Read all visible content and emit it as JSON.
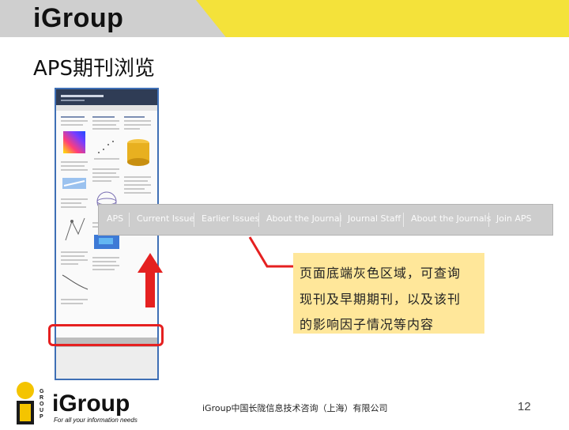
{
  "header": {
    "logo_text": "iGroup",
    "grey": "#cfcfcf",
    "yellow": "#f4e23a"
  },
  "slide": {
    "title": "APS期刊浏览"
  },
  "navbar": {
    "items": [
      "APS",
      "Current Issue",
      "Earlier Issues",
      "About the Journal",
      "Journal Staff",
      "About the Journals",
      "Join APS"
    ]
  },
  "callout": {
    "lines": [
      "页面底端灰色区域，可查询",
      "现刊及早期期刊，以及该刊",
      "的影响因子情况等内容"
    ],
    "color": "#ffe79a"
  },
  "highlight": {
    "color": "#e52020"
  },
  "footer": {
    "logo_text": "iGroup",
    "logo_vertical": "GROUP",
    "tagline": "For all your information needs",
    "company": "iGroup中国长陇信息技术咨询（上海）有限公司",
    "page_number": "12"
  }
}
